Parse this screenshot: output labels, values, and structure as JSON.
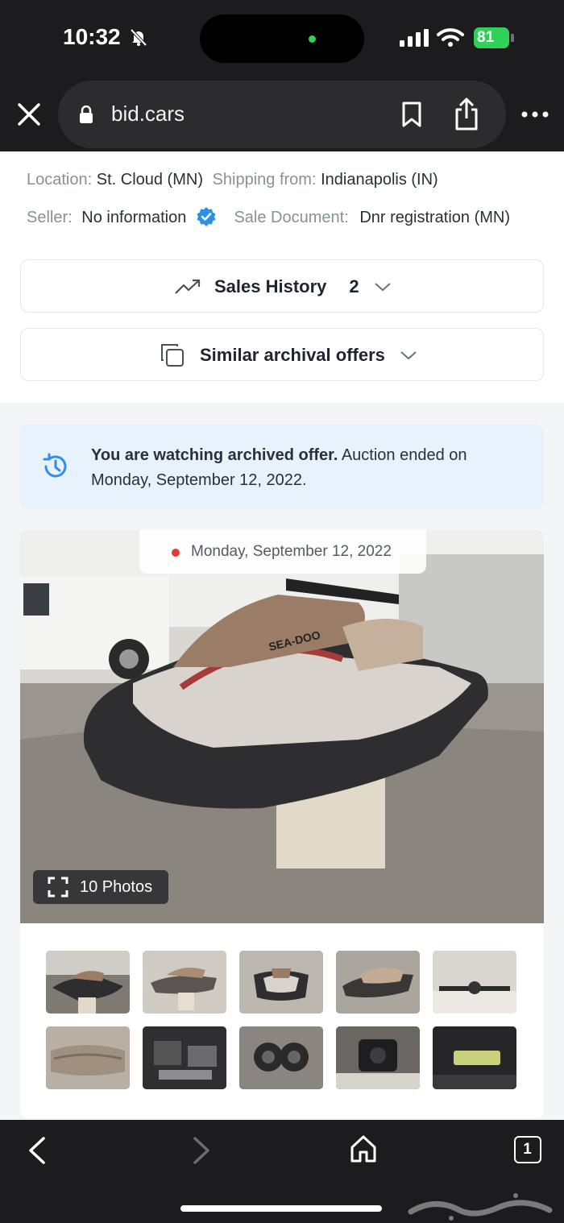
{
  "status": {
    "time": "10:32",
    "battery": "81"
  },
  "browser": {
    "url": "bid.cars",
    "tab_count": "1"
  },
  "details": {
    "location_label": "Location:",
    "location_value": "St. Cloud (MN)",
    "shipping_label": "Shipping from:",
    "shipping_value": "Indianapolis (IN)",
    "seller_label": "Seller:",
    "seller_value": "No information",
    "sale_doc_label": "Sale Document:",
    "sale_doc_value": "Dnr registration (MN)"
  },
  "sales_history": {
    "label": "Sales History",
    "count": "2"
  },
  "similar": {
    "label": "Similar archival offers"
  },
  "notice": {
    "bold": "You are watching archived offer.",
    "text": " Auction ended on Monday, September 12, 2022."
  },
  "gallery": {
    "date": "Monday, September 12, 2022",
    "photos_label": "10 Photos",
    "hull_logo": "SEA-DOO"
  },
  "colors": {
    "accent": "#2f8fe8",
    "notice_bg": "#e7f2fd",
    "live_dot": "#e53935"
  }
}
